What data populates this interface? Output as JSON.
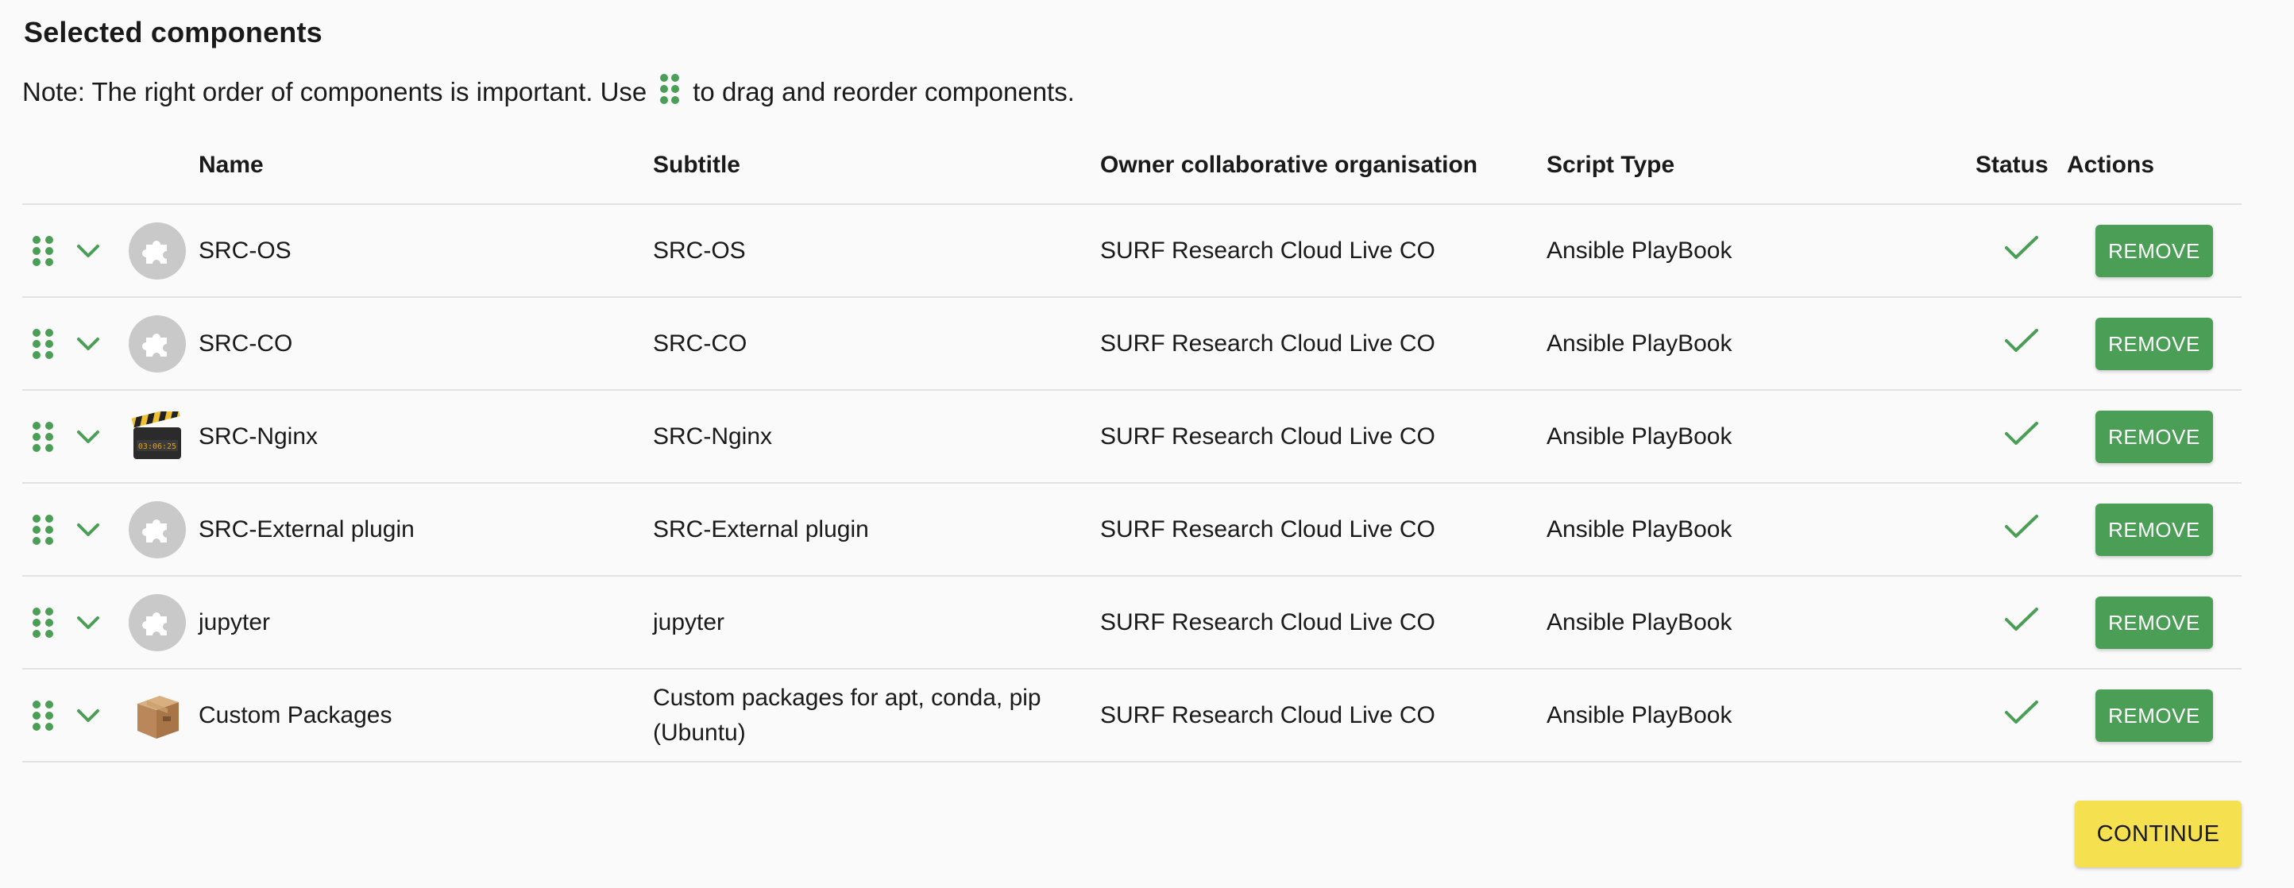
{
  "section": {
    "title": "Selected components",
    "note_before": "Note: The right order of components is important. Use",
    "note_after": "to drag and reorder components.",
    "note_icon": "drag-handle-icon"
  },
  "colors": {
    "accent_green": "#4a9e55",
    "continue_yellow": "#f5e04f",
    "avatar_gray": "#c9c9c9",
    "divider": "#e2e2e2"
  },
  "table": {
    "headers": {
      "name": "Name",
      "subtitle": "Subtitle",
      "owner": "Owner collaborative organisation",
      "script_type": "Script Type",
      "status": "Status",
      "actions": "Actions"
    },
    "rows": [
      {
        "name": "SRC-OS",
        "subtitle": "SRC-OS",
        "owner": "SURF Research Cloud Live CO",
        "script_type": "Ansible PlayBook",
        "status": "ok",
        "icon": "puzzle-icon",
        "action_label": "REMOVE"
      },
      {
        "name": "SRC-CO",
        "subtitle": "SRC-CO",
        "owner": "SURF Research Cloud Live CO",
        "script_type": "Ansible PlayBook",
        "status": "ok",
        "icon": "puzzle-icon",
        "action_label": "REMOVE"
      },
      {
        "name": "SRC-Nginx",
        "subtitle": "SRC-Nginx",
        "owner": "SURF Research Cloud Live CO",
        "script_type": "Ansible PlayBook",
        "status": "ok",
        "icon": "clapperboard-icon",
        "action_label": "REMOVE"
      },
      {
        "name": "SRC-External plugin",
        "subtitle": "SRC-External plugin",
        "owner": "SURF Research Cloud Live CO",
        "script_type": "Ansible PlayBook",
        "status": "ok",
        "icon": "puzzle-icon",
        "action_label": "REMOVE"
      },
      {
        "name": "jupyter",
        "subtitle": "jupyter",
        "owner": "SURF Research Cloud Live CO",
        "script_type": "Ansible PlayBook",
        "status": "ok",
        "icon": "puzzle-icon",
        "action_label": "REMOVE"
      },
      {
        "name": "Custom Packages",
        "subtitle": "Custom packages for apt, conda, pip (Ubuntu)",
        "owner": "SURF Research Cloud Live CO",
        "script_type": "Ansible PlayBook",
        "status": "ok",
        "icon": "cardboard-box-icon",
        "action_label": "REMOVE"
      }
    ]
  },
  "footer": {
    "continue_label": "CONTINUE"
  }
}
